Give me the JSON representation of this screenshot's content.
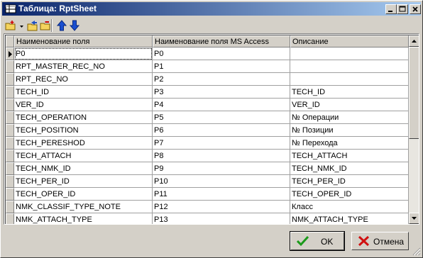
{
  "window": {
    "title": "Таблица: RptSheet",
    "title_bar_colors": [
      "#0a246a",
      "#a6caf0"
    ],
    "controls": [
      "minimize-icon",
      "maximize-icon",
      "close-icon"
    ]
  },
  "toolbar": {
    "buttons": [
      "add-field-icon",
      "dropdown-arrow-icon",
      "copy-field-icon",
      "delete-field-icon",
      "move-up-icon",
      "move-down-icon"
    ]
  },
  "grid": {
    "columns": [
      "Наименование поля",
      "Наименование поля MS Access",
      "Описание"
    ],
    "rows": [
      {
        "name": "P0",
        "access": "P0",
        "desc": ""
      },
      {
        "name": "RPT_MASTER_REC_NO",
        "access": "P1",
        "desc": ""
      },
      {
        "name": "RPT_REC_NO",
        "access": "P2",
        "desc": ""
      },
      {
        "name": "TECH_ID",
        "access": "P3",
        "desc": "TECH_ID"
      },
      {
        "name": "VER_ID",
        "access": "P4",
        "desc": "VER_ID"
      },
      {
        "name": "TECH_OPERATION",
        "access": "P5",
        "desc": "№ Операции"
      },
      {
        "name": "TECH_POSITION",
        "access": "P6",
        "desc": "№ Позиции"
      },
      {
        "name": "TECH_PERESHOD",
        "access": "P7",
        "desc": "№ Перехода"
      },
      {
        "name": "TECH_ATTACH",
        "access": "P8",
        "desc": "TECH_ATTACH"
      },
      {
        "name": "TECH_NMK_ID",
        "access": "P9",
        "desc": "TECH_NMK_ID"
      },
      {
        "name": "TECH_PER_ID",
        "access": "P10",
        "desc": "TECH_PER_ID"
      },
      {
        "name": "TECH_OPER_ID",
        "access": "P11",
        "desc": "TECH_OPER_ID"
      },
      {
        "name": "NMK_CLASSIF_TYPE_NOTE",
        "access": "P12",
        "desc": "Класс"
      },
      {
        "name": "NMK_ATTACH_TYPE",
        "access": "P13",
        "desc": "NMK_ATTACH_TYPE"
      }
    ],
    "selected_row": 0
  },
  "buttons": {
    "ok_label": "OK",
    "cancel_label": "Отмена"
  }
}
